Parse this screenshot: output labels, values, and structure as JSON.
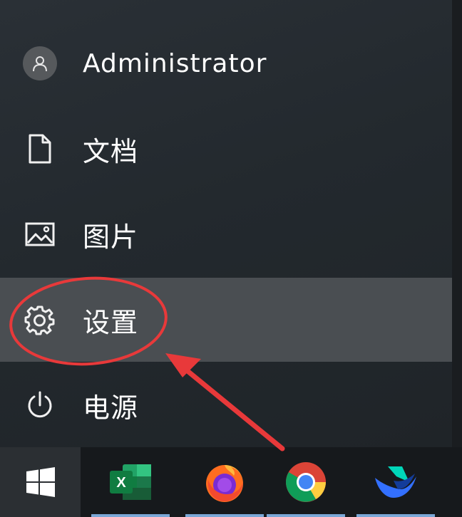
{
  "start_menu": {
    "user": {
      "name": "Administrator",
      "icon": "user-icon"
    },
    "items": [
      {
        "label": "文档",
        "icon": "document-icon"
      },
      {
        "label": "图片",
        "icon": "picture-icon"
      },
      {
        "label": "设置",
        "icon": "gear-icon",
        "highlighted": true
      },
      {
        "label": "电源",
        "icon": "power-icon"
      }
    ]
  },
  "taskbar": {
    "start_icon": "windows-logo-icon",
    "apps": [
      {
        "name": "excel",
        "icon": "excel-icon",
        "glyph": "X"
      },
      {
        "name": "firefox",
        "icon": "firefox-icon"
      },
      {
        "name": "chrome",
        "icon": "chrome-icon"
      },
      {
        "name": "feishu",
        "icon": "feishu-icon"
      }
    ]
  },
  "colors": {
    "menu_bg": "#262b30",
    "highlight_bg": "#4a4e52",
    "annotation_red": "#e8393a",
    "taskbar_bg": "#16191c",
    "app_underline": "#7aa7d6"
  }
}
